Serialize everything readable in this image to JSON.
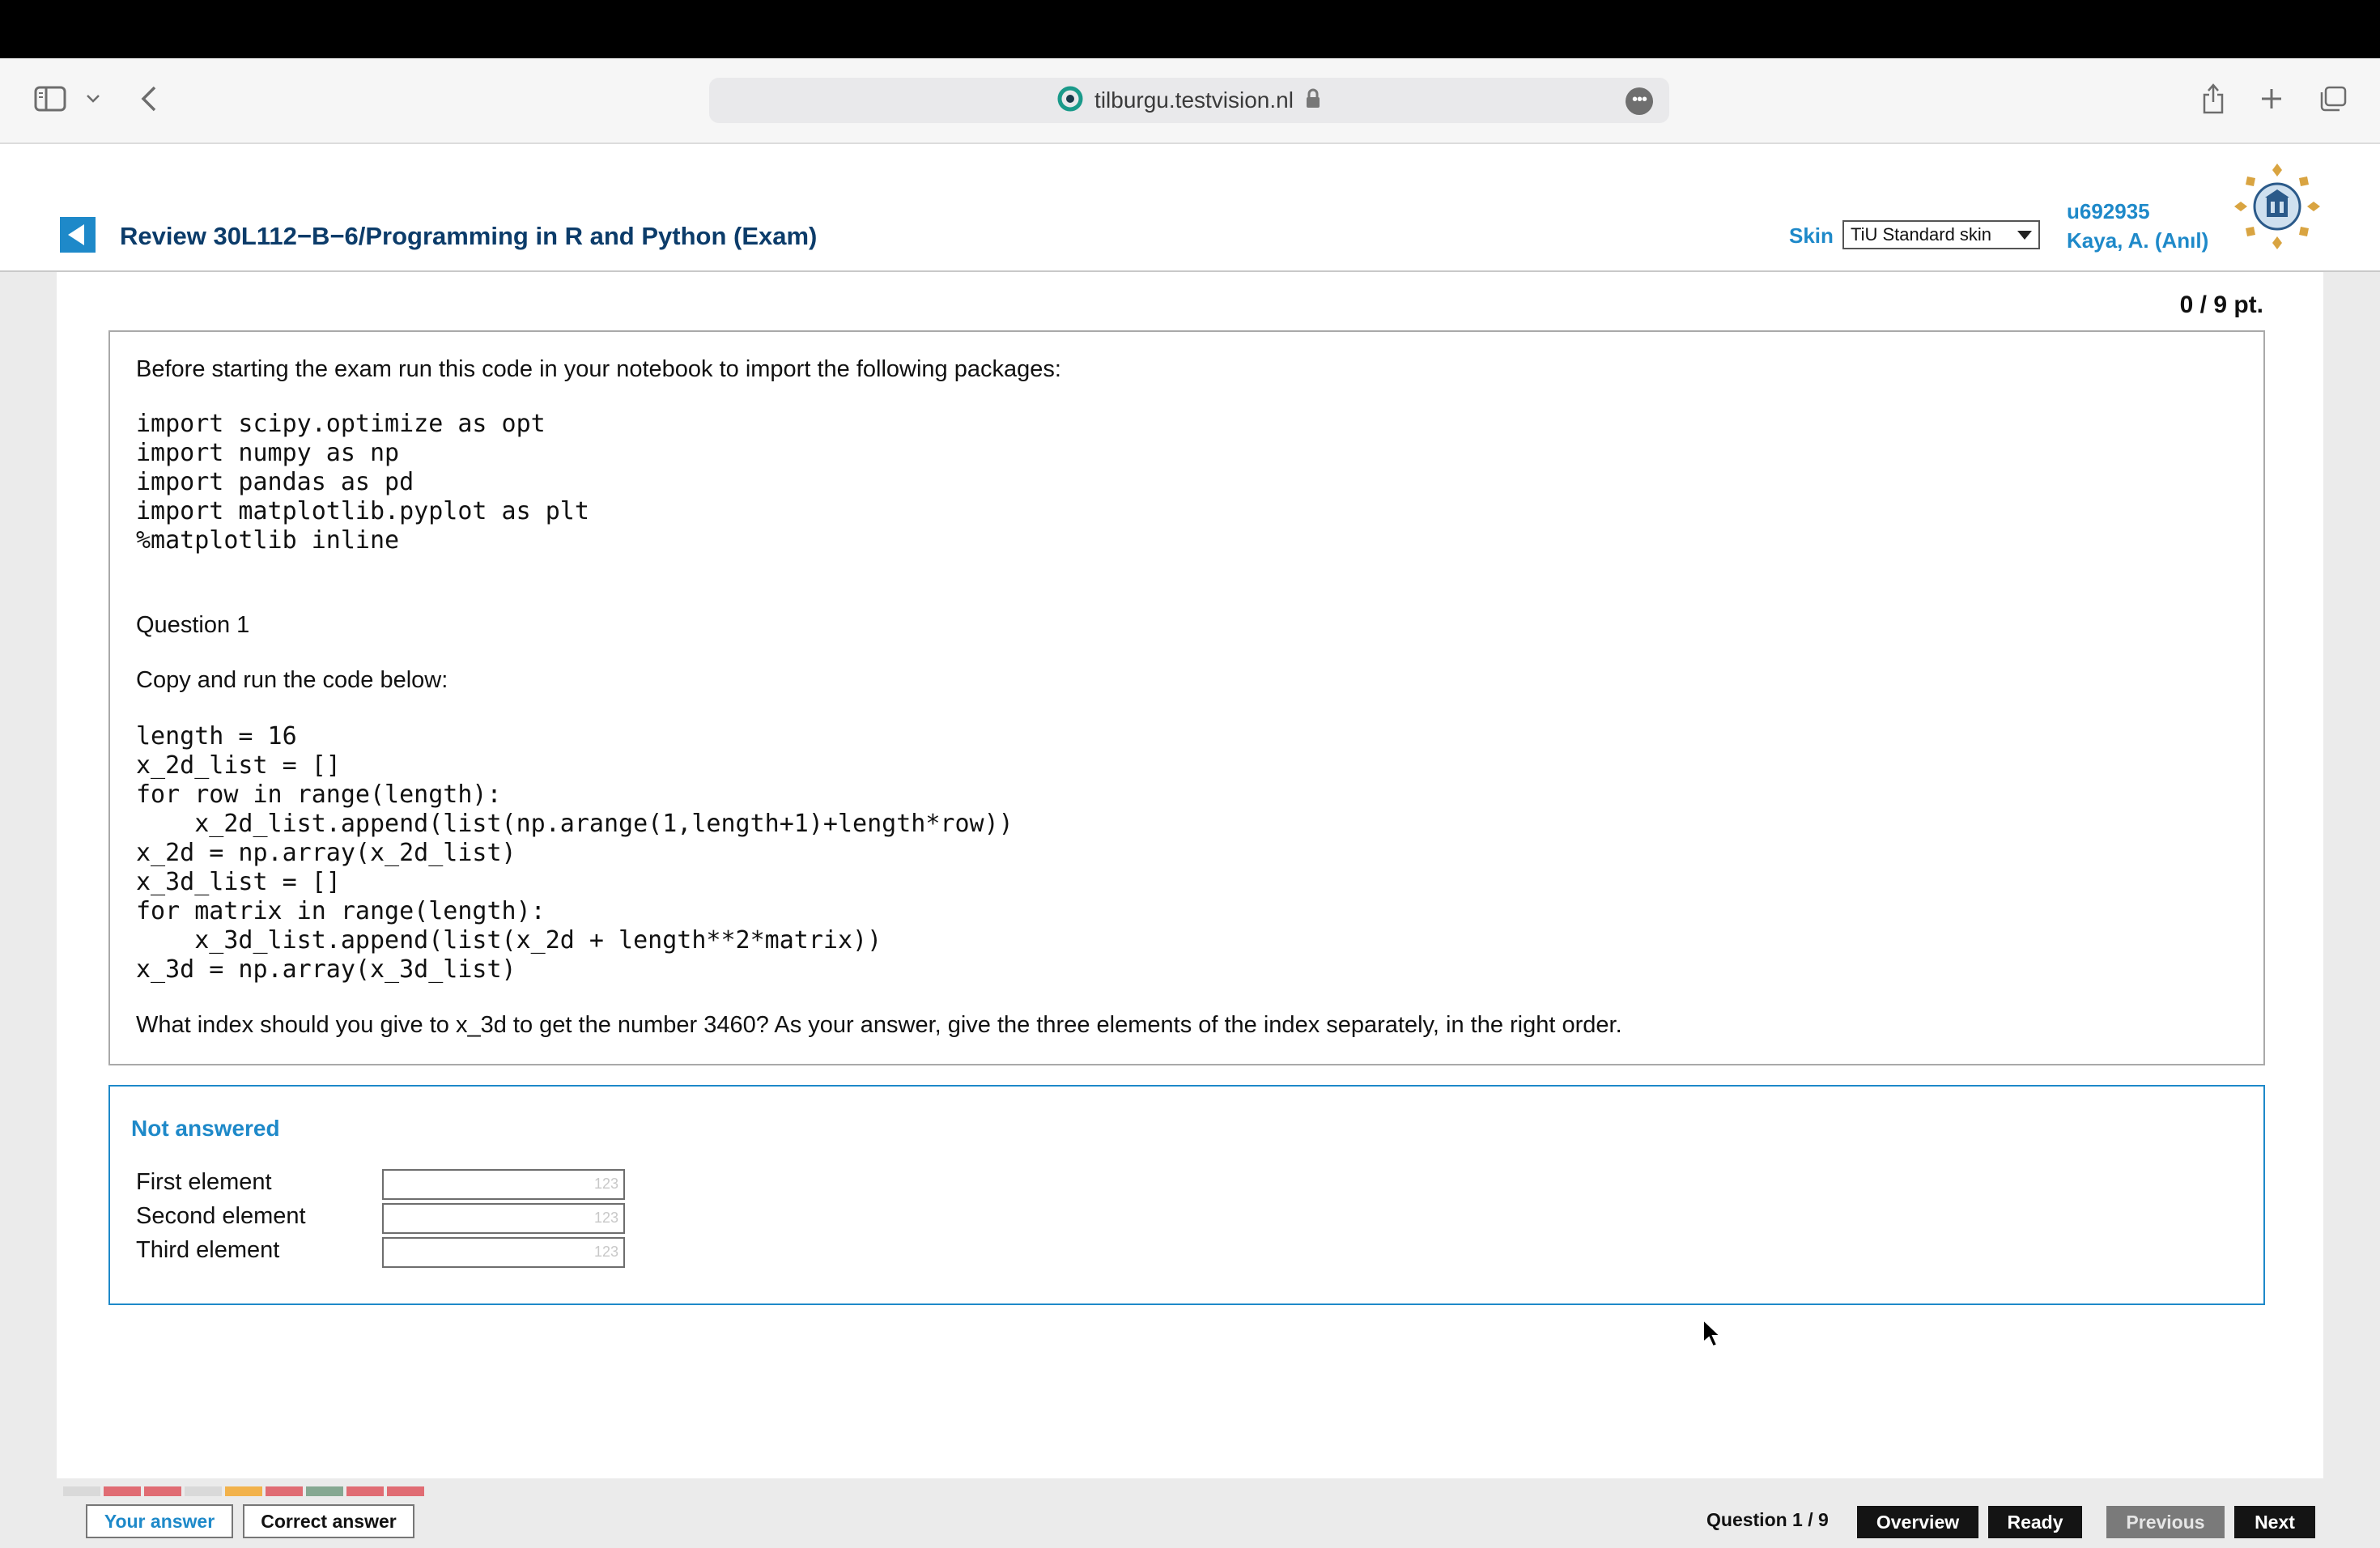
{
  "browser": {
    "url": "tilburgu.testvision.nl"
  },
  "header": {
    "title": "Review 30L112−B−6/Programming in R and Python (Exam)",
    "skin_label": "Skin",
    "skin_value": "TiU Standard skin",
    "user_id": "u692935",
    "user_name": "Kaya, A. (Anıl)"
  },
  "question": {
    "points": "0 / 9 pt.",
    "intro": "Before starting the exam run this code in your notebook to import the following packages:",
    "import_code": "import scipy.optimize as opt\nimport numpy as np\nimport pandas as pd\nimport matplotlib.pyplot as plt\n%matplotlib inline",
    "heading": "Question 1",
    "instruction": "Copy and run the code below:",
    "task_code": "length = 16\nx_2d_list = []\nfor row in range(length):\n    x_2d_list.append(list(np.arange(1,length+1)+length*row))\nx_2d = np.array(x_2d_list)\nx_3d_list = []\nfor matrix in range(length):\n    x_3d_list.append(list(x_2d + length**2*matrix))\nx_3d = np.array(x_3d_list)",
    "prompt": "What index should you give to x_3d to get the number 3460? As your answer, give the three elements of the index separately, in the right order."
  },
  "answer": {
    "status": "Not answered",
    "fields": [
      {
        "label": "First element",
        "value": "",
        "hint": "123"
      },
      {
        "label": "Second element",
        "value": "",
        "hint": "123"
      },
      {
        "label": "Third element",
        "value": "",
        "hint": "123"
      }
    ]
  },
  "footer": {
    "progress_colors": [
      "#d9d9d9",
      "#e06c73",
      "#e06c73",
      "#d9d9d9",
      "#f2b24b",
      "#e06c73",
      "#86a892",
      "#e06c73",
      "#e06c73"
    ],
    "your_answer": "Your answer",
    "correct_answer": "Correct answer",
    "question_counter": "Question 1 / 9",
    "overview": "Overview",
    "ready": "Ready",
    "previous": "Previous",
    "next": "Next"
  },
  "colors": {
    "accent": "#1e89c9",
    "title": "#0c3c6a"
  }
}
